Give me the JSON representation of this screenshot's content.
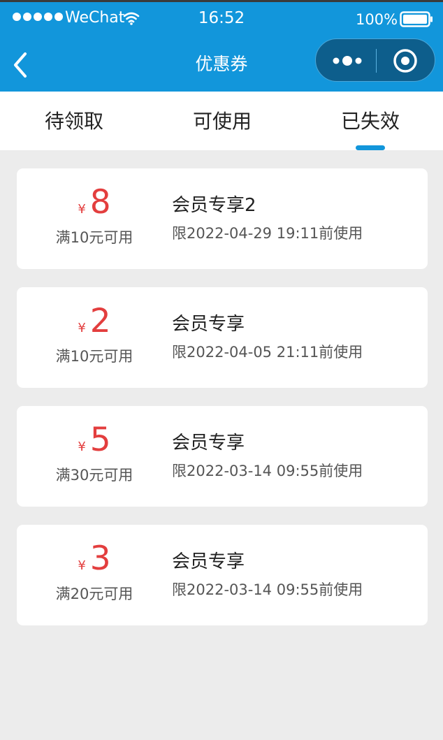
{
  "status_bar": {
    "carrier": "WeChat",
    "time": "16:52",
    "battery": "100%"
  },
  "nav": {
    "title": "优惠券"
  },
  "tabs": [
    {
      "label": "待领取"
    },
    {
      "label": "可使用"
    },
    {
      "label": "已失效"
    }
  ],
  "active_tab": "已失效",
  "coupons": [
    {
      "currency": "¥",
      "amount": "8",
      "condition": "满10元可用",
      "title": "会员专享2",
      "expiry": "限2022-04-29 19:11前使用"
    },
    {
      "currency": "¥",
      "amount": "2",
      "condition": "满10元可用",
      "title": "会员专享",
      "expiry": "限2022-04-05 21:11前使用"
    },
    {
      "currency": "¥",
      "amount": "5",
      "condition": "满30元可用",
      "title": "会员专享",
      "expiry": "限2022-03-14 09:55前使用"
    },
    {
      "currency": "¥",
      "amount": "3",
      "condition": "满20元可用",
      "title": "会员专享",
      "expiry": "限2022-03-14 09:55前使用"
    }
  ],
  "colors": {
    "nav_bar": "#1296db",
    "accent_red": "#e33e3e",
    "page_background": "#ececec"
  }
}
